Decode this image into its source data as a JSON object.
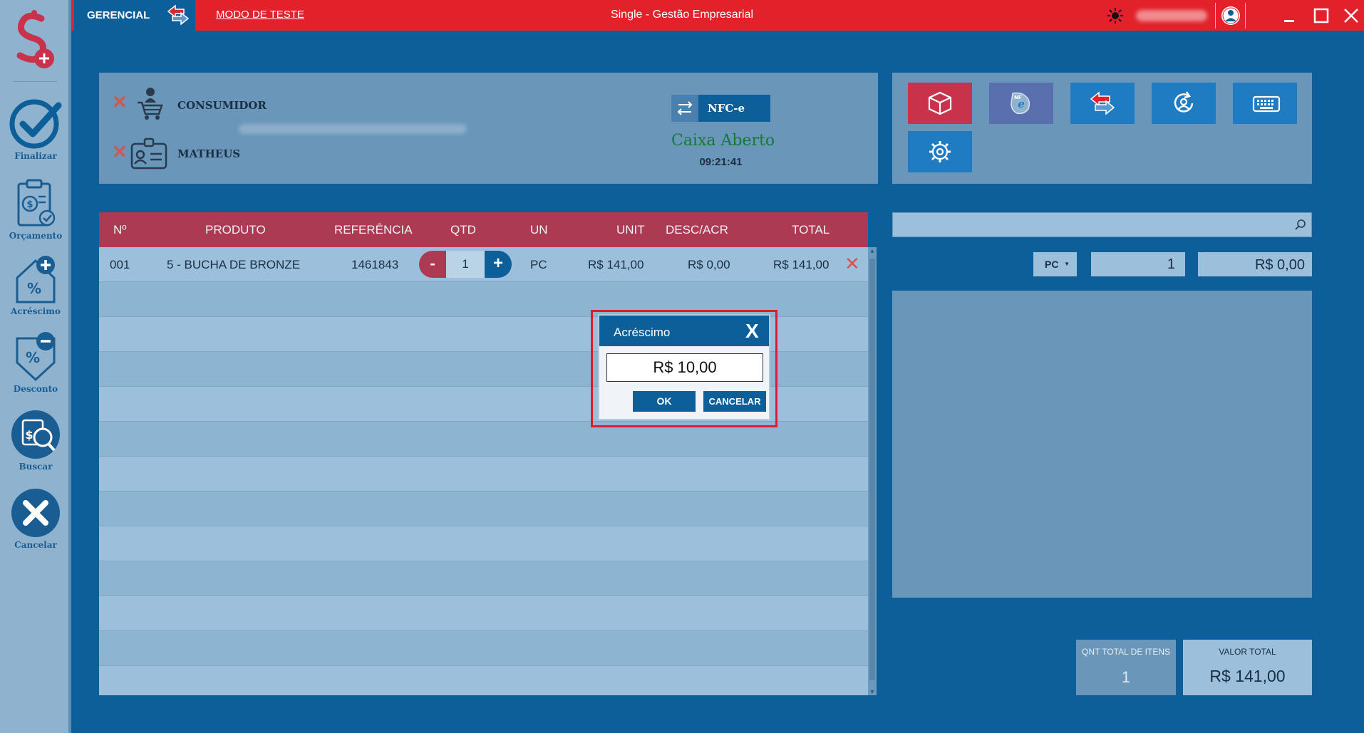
{
  "titlebar": {
    "mode": "GERENCIAL",
    "test_mode_link": "MODO DE TESTE",
    "title": "Single - Gestão Empresarial"
  },
  "sidebar": {
    "items": [
      {
        "label": "Finalizar",
        "icon": "check-circle-icon"
      },
      {
        "label": "Orçamento",
        "icon": "clipboard-icon"
      },
      {
        "label": "Acréscimo",
        "icon": "surcharge-icon"
      },
      {
        "label": "Desconto",
        "icon": "discount-icon"
      },
      {
        "label": "Buscar",
        "icon": "search-calculator-icon"
      },
      {
        "label": "Cancelar",
        "icon": "cancel-icon"
      }
    ]
  },
  "header": {
    "customer_label": "CONSUMIDOR",
    "seller_label": "MATHEUS",
    "fiscal_doc": "NFC-e",
    "cash_status": "Caixa Aberto",
    "clock": "09:21:41"
  },
  "actions": [
    {
      "icon": "box-icon",
      "color": "#c8324a"
    },
    {
      "icon": "nfe-icon",
      "color": "#5a6fae"
    },
    {
      "icon": "swap-arrows-icon",
      "color": "#1f7bc2"
    },
    {
      "icon": "refresh-user-icon",
      "color": "#1f7bc2"
    },
    {
      "icon": "keyboard-icon",
      "color": "#1f7bc2"
    },
    {
      "icon": "settings-icon",
      "color": "#1f7bc2"
    }
  ],
  "table": {
    "columns": [
      "Nº",
      "PRODUTO",
      "REFERÊNCIA",
      "QTD",
      "UN",
      "UNIT",
      "DESC/ACR",
      "TOTAL"
    ],
    "rows": [
      {
        "num": "001",
        "produto": "5 - BUCHA DE BRONZE",
        "ref": "1461843",
        "qtd": "1",
        "un": "PC",
        "unit": "R$ 141,00",
        "desc": "R$ 0,00",
        "total": "R$ 141,00"
      }
    ]
  },
  "entry": {
    "search_placeholder": "",
    "unit": "PC",
    "quantity": "1",
    "price": "R$ 0,00"
  },
  "totals": {
    "items_label": "QNT TOTAL DE ITENS",
    "items_value": "1",
    "value_label": "VALOR TOTAL",
    "value": "R$ 141,00"
  },
  "dialog": {
    "title": "Acréscimo",
    "close": "X",
    "value": "R$ 10,00",
    "ok": "OK",
    "cancel": "CANCELAR"
  },
  "colors": {
    "titlebar": "#e2212b",
    "primary": "#0d5f99",
    "table_header": "#ac3a52",
    "cash_open": "#137a35"
  }
}
